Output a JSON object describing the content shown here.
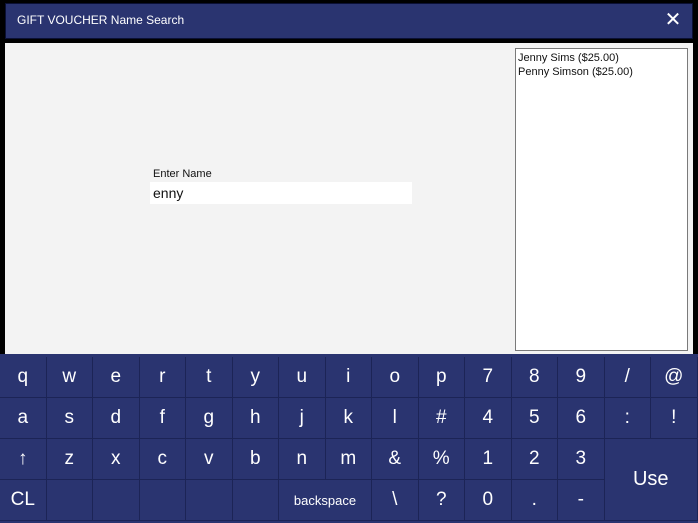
{
  "window": {
    "title": "GIFT VOUCHER Name Search",
    "close_symbol": "✕"
  },
  "form": {
    "label": "Enter Name",
    "value": "enny"
  },
  "results": [
    "Jenny Sims ($25.00)",
    "Penny Simson ($25.00)"
  ],
  "keyboard": {
    "row1": [
      "q",
      "w",
      "e",
      "r",
      "t",
      "y",
      "u",
      "i",
      "o",
      "p",
      "7",
      "8",
      "9",
      "/",
      "@"
    ],
    "row2": [
      "a",
      "s",
      "d",
      "f",
      "g",
      "h",
      "j",
      "k",
      "l",
      "#",
      "4",
      "5",
      "6",
      ":",
      "!"
    ],
    "row3": [
      "↑",
      "z",
      "x",
      "c",
      "v",
      "b",
      "n",
      "m",
      "&",
      "%",
      "1",
      "2",
      "3"
    ],
    "row4_cl": "CL",
    "row4_backspace": "backspace",
    "row4_rest": [
      "\\",
      "?",
      "0",
      ".",
      "-"
    ],
    "use": "Use"
  }
}
